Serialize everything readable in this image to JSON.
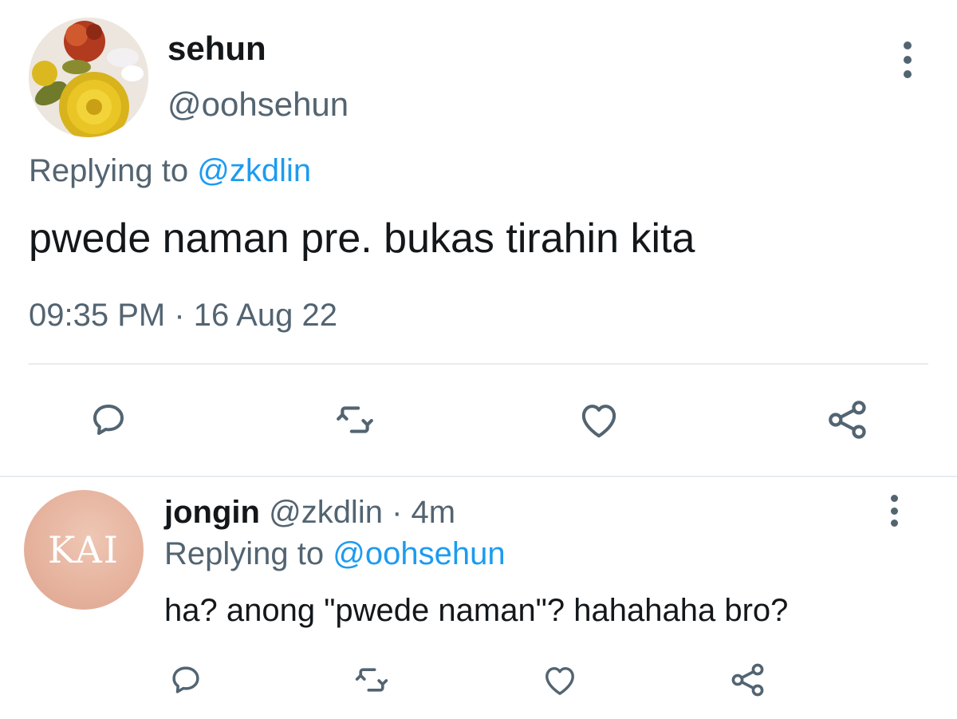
{
  "main_tweet": {
    "display_name": "sehun",
    "handle": "@oohsehun",
    "replying_prefix": "Replying to",
    "replying_to": "@zkdlin",
    "text": "pwede naman pre. bukas tirahin kita",
    "timestamp": "09:35 PM · 16 Aug 22",
    "actions": [
      "reply-icon",
      "retweet-icon",
      "like-icon",
      "share-icon"
    ]
  },
  "reply_tweet": {
    "display_name": "jongin",
    "meta": " @zkdlin · 4m",
    "replying_prefix": "Replying to",
    "replying_to": "@oohsehun",
    "text": "ha? anong \"pwede naman\"? hahahaha bro?",
    "avatar_text": "KAI",
    "actions": [
      "reply-icon",
      "retweet-icon",
      "like-icon",
      "share-icon"
    ]
  },
  "colors": {
    "primary_text": "#14171a",
    "secondary_text": "#536471",
    "link": "#1d9bf0",
    "divider": "#e6ecf0"
  }
}
